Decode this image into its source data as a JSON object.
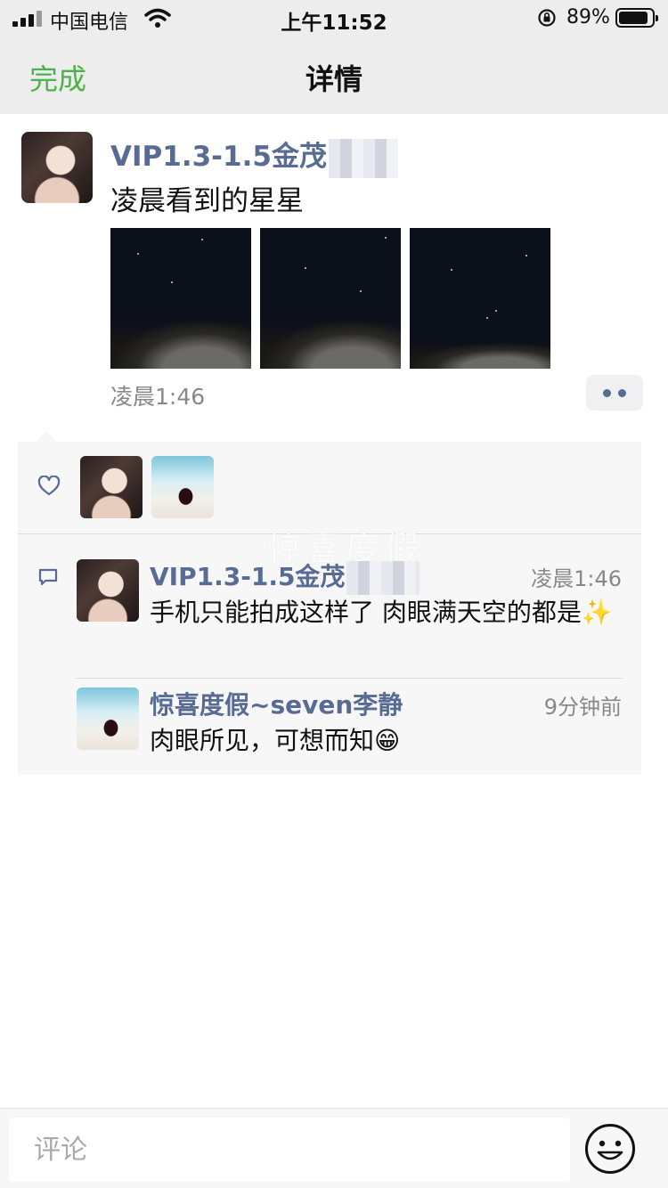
{
  "status_bar": {
    "carrier": "中国电信",
    "time": "上午11:52",
    "battery_percent": "89%",
    "battery_level": 0.89,
    "icons": [
      "signal-icon",
      "wifi-icon",
      "orientation-lock-icon",
      "battery-icon"
    ]
  },
  "nav": {
    "done_label": "完成",
    "title": "详情"
  },
  "post": {
    "author_name": "VIP1.3-1.5金茂",
    "text": "凌晨看到的星星",
    "time": "凌晨1:46",
    "photo_count": 3,
    "more_icon": "more-dots-icon"
  },
  "likes": {
    "icon": "heart-outline-icon"
  },
  "comments": [
    {
      "name": "VIP1.3-1.5金茂",
      "time": "凌晨1:46",
      "text": "手机只能拍成这样了 肉眼满天空的都是✨"
    },
    {
      "name": "惊喜度假~seven李静",
      "time": "9分钟前",
      "text": "肉眼所见，可想而知😁"
    }
  ],
  "watermark": "惊喜度假",
  "input": {
    "placeholder": "评论",
    "emoji_icon": "smiley-face-icon"
  },
  "colors": {
    "accent_green": "#4cb34a",
    "link_blue": "#576b95",
    "bar_gray": "#ededed"
  }
}
